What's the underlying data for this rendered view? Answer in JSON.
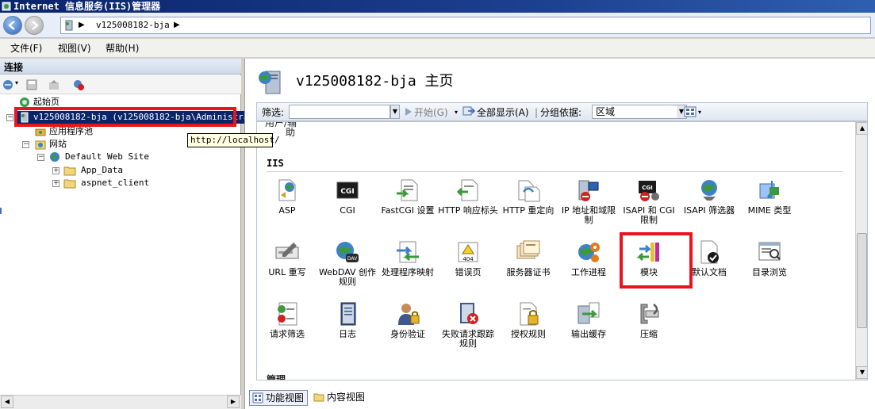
{
  "window": {
    "title": "Internet 信息服务(IIS)管理器"
  },
  "address": {
    "crumb": "v125008182-bja"
  },
  "menu": {
    "items": [
      "文件(F)",
      "视图(V)",
      "帮助(H)"
    ]
  },
  "connections": {
    "header": "连接",
    "tree": {
      "start_page": "起始页",
      "server": "v125008182-bja (v125008182-bja\\Administrat",
      "app_pools": "应用程序池",
      "sites": "网站",
      "default_site": "Default Web Site",
      "app_data": "App_Data",
      "aspnet_client": "aspnet_client"
    },
    "tooltip": "http://localhost/"
  },
  "main": {
    "title": "v125008182-bja 主页",
    "filter": {
      "label": "筛选:",
      "start_label": "开始(G)",
      "show_all_label": "全部显示(A)",
      "group_label": "分组依据:",
      "group_value": "区域"
    },
    "prev_group_fragment_1": "用户/辅",
    "prev_group_fragment_2": "助",
    "section_iis": "IIS",
    "next_section_fragment": "管理",
    "features": [
      {
        "label": "ASP",
        "icon": "asp-icon"
      },
      {
        "label": "CGI",
        "icon": "cgi-icon"
      },
      {
        "label": "FastCGI 设置",
        "icon": "fastcgi-icon"
      },
      {
        "label": "HTTP 响应标头",
        "icon": "http-response-headers-icon"
      },
      {
        "label": "HTTP 重定向",
        "icon": "http-redirect-icon"
      },
      {
        "label": "IP 地址和域限制",
        "icon": "ip-domain-restrictions-icon"
      },
      {
        "label": "ISAPI 和 CGI 限制",
        "icon": "isapi-cgi-restrictions-icon"
      },
      {
        "label": "ISAPI 筛选器",
        "icon": "isapi-filters-icon"
      },
      {
        "label": "MIME 类型",
        "icon": "mime-types-icon"
      },
      {
        "label": "URL 重写",
        "icon": "url-rewrite-icon"
      },
      {
        "label": "WebDAV 创作规则",
        "icon": "webdav-icon"
      },
      {
        "label": "处理程序映射",
        "icon": "handler-mappings-icon"
      },
      {
        "label": "错误页",
        "icon": "error-pages-icon"
      },
      {
        "label": "服务器证书",
        "icon": "server-certificates-icon"
      },
      {
        "label": "工作进程",
        "icon": "worker-processes-icon"
      },
      {
        "label": "模块",
        "icon": "modules-icon"
      },
      {
        "label": "默认文档",
        "icon": "default-document-icon"
      },
      {
        "label": "目录浏览",
        "icon": "directory-browsing-icon"
      },
      {
        "label": "请求筛选",
        "icon": "request-filtering-icon"
      },
      {
        "label": "日志",
        "icon": "logging-icon"
      },
      {
        "label": "身份验证",
        "icon": "authentication-icon"
      },
      {
        "label": "失败请求跟踪规则",
        "icon": "failed-request-tracing-icon"
      },
      {
        "label": "授权规则",
        "icon": "authorization-rules-icon"
      },
      {
        "label": "输出缓存",
        "icon": "output-caching-icon"
      },
      {
        "label": "压缩",
        "icon": "compression-icon"
      }
    ],
    "tabs": {
      "features_view": "功能视图",
      "content_view": "内容视图"
    }
  },
  "colors": {
    "highlight": "#e8151f",
    "title_bar": "#0a246a"
  }
}
